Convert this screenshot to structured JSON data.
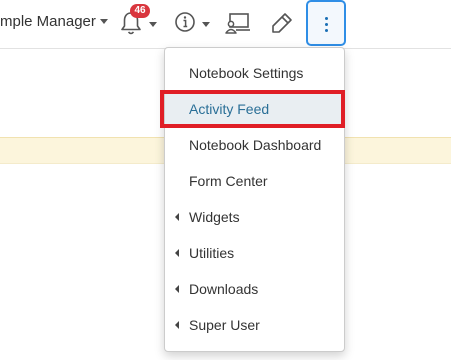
{
  "navbar": {
    "user_menu_label": "mple Manager",
    "notifications_count": "46"
  },
  "menu": {
    "items": [
      {
        "label": "Notebook Settings"
      },
      {
        "label": "Activity Feed"
      },
      {
        "label": "Notebook Dashboard"
      },
      {
        "label": "Form Center"
      },
      {
        "label": "Widgets"
      },
      {
        "label": "Utilities"
      },
      {
        "label": "Downloads"
      },
      {
        "label": "Super User"
      }
    ]
  },
  "colors": {
    "accent": "#2f8ee6",
    "badge": "#d9363e",
    "highlight": "#e01e26",
    "active_item_text": "#2a6f97",
    "notice_strip": "#fcf5dc"
  }
}
